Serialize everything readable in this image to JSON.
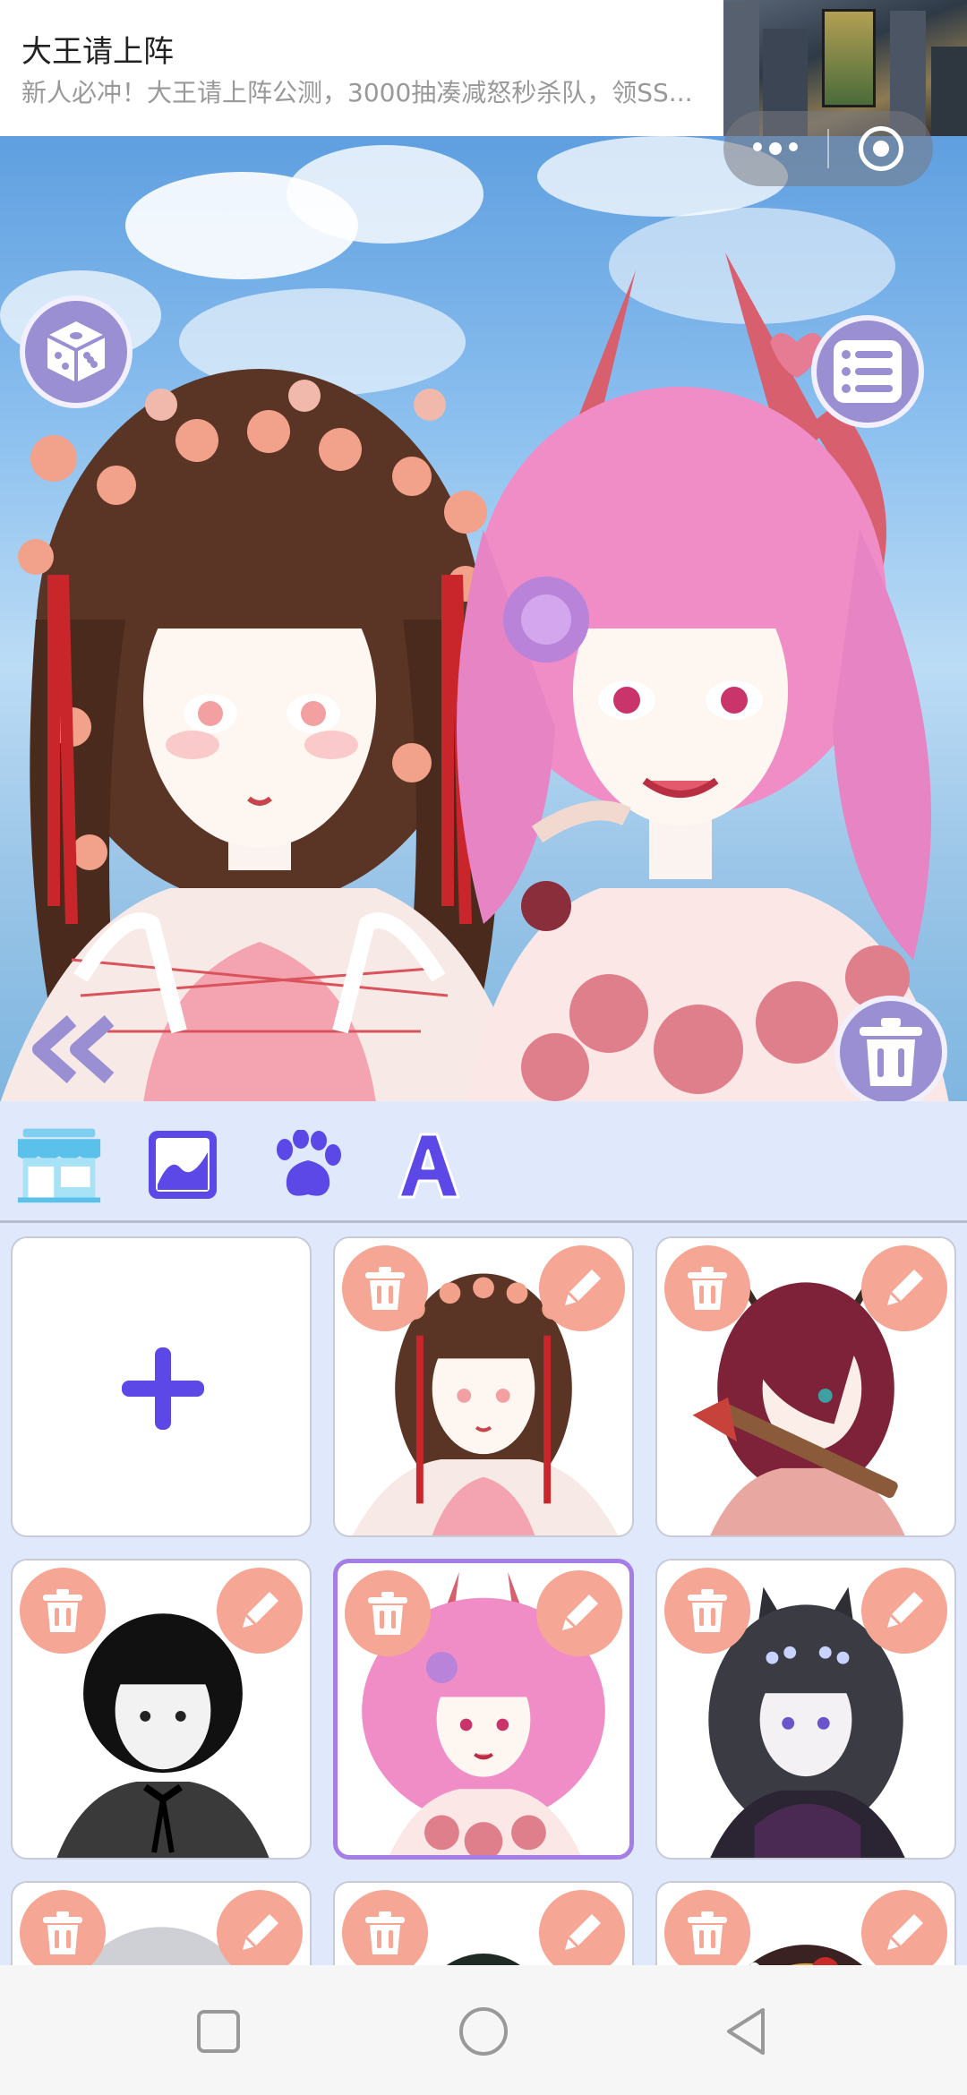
{
  "ad": {
    "title": "大王请上阵",
    "subtitle": "新人必冲！大王请上阵公测，3000抽凑减怒秒杀队，领SS..."
  },
  "capsule": {
    "menu_icon": "more-dots-icon",
    "close_icon": "target-close-icon"
  },
  "canvas": {
    "left_button_icon": "dice-icon",
    "right_button_icon": "list-menu-icon",
    "back_icon": "double-chevron-left-icon",
    "delete_icon": "trash-icon",
    "characters": [
      "flower-crown-girl",
      "pink-horned-girl"
    ]
  },
  "toolbar": {
    "items": [
      {
        "icon": "shop-icon",
        "active": true
      },
      {
        "icon": "background-image-icon",
        "active": false
      },
      {
        "icon": "paw-icon",
        "active": false
      },
      {
        "icon": "text-icon",
        "active": false
      }
    ]
  },
  "grid": {
    "add_icon": "plus-icon",
    "cards": [
      {
        "type": "add"
      },
      {
        "type": "avatar",
        "name": "flower-crown-girl",
        "selected": false
      },
      {
        "type": "avatar",
        "name": "antler-axe-girl",
        "selected": false
      },
      {
        "type": "avatar",
        "name": "monochrome-girl",
        "selected": false
      },
      {
        "type": "avatar",
        "name": "pink-horned-girl",
        "selected": true
      },
      {
        "type": "avatar",
        "name": "fox-ear-girl",
        "selected": false
      },
      {
        "type": "avatar",
        "name": "silver-hair-girl",
        "selected": false
      },
      {
        "type": "avatar",
        "name": "dark-hood-girl",
        "selected": false
      },
      {
        "type": "avatar",
        "name": "rabbit-ornament-girl",
        "selected": false
      }
    ]
  },
  "colors": {
    "accent": "#9a8fd2",
    "card_button": "#f6a694",
    "selected_border": "#a47ee6",
    "icon_purple": "#5b48e6"
  },
  "navbar": {
    "items": [
      "square-recent-icon",
      "circle-home-icon",
      "triangle-back-icon"
    ]
  }
}
